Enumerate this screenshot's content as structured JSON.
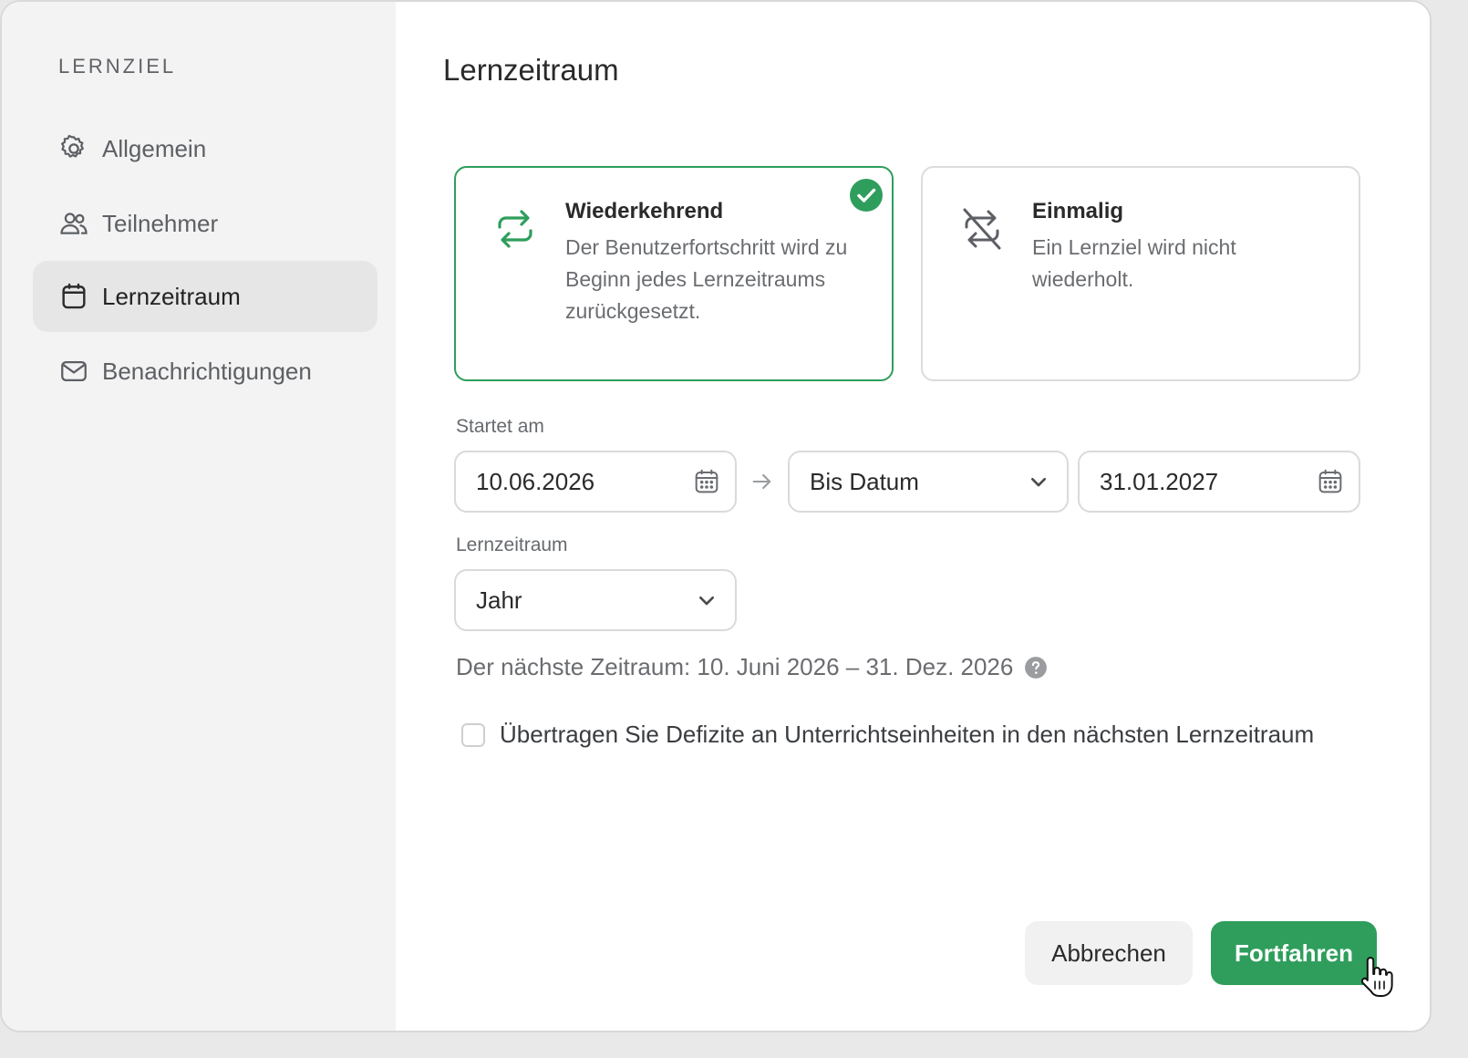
{
  "sidebar": {
    "heading": "LERNZIEL",
    "items": [
      {
        "label": "Allgemein",
        "icon": "gear-icon"
      },
      {
        "label": "Teilnehmer",
        "icon": "users-icon"
      },
      {
        "label": "Lernzeitraum",
        "icon": "calendar-icon",
        "active": true
      },
      {
        "label": "Benachrichtigungen",
        "icon": "mail-icon"
      }
    ]
  },
  "main": {
    "title": "Lernzeitraum",
    "options": [
      {
        "title": "Wiederkehrend",
        "description": "Der Benutzerfortschritt wird zu Beginn jedes Lernzeitraums zurückgesetzt.",
        "icon": "repeat-icon",
        "selected": true
      },
      {
        "title": "Einmalig",
        "description": "Ein Lernziel wird nicht wiederholt.",
        "icon": "no-repeat-icon",
        "selected": false
      }
    ],
    "start_label": "Startet am",
    "start_date": "10.06.2026",
    "end_mode": "Bis Datum",
    "end_date": "31.01.2027",
    "period_label": "Lernzeitraum",
    "period_value": "Jahr",
    "next_period_text": "Der nächste Zeitraum: 10. Juni 2026 – 31. Dez. 2026",
    "carry_over_label": "Übertragen Sie Defizite an Unterrichtseinheiten in den nächsten Lernzeitraum",
    "carry_over_checked": false
  },
  "footer": {
    "cancel_label": "Abbrechen",
    "continue_label": "Fortfahren"
  },
  "colors": {
    "accent": "#2f9e5c",
    "sidebar_bg": "#f3f3f3",
    "active_item_bg": "#e6e6e6"
  }
}
